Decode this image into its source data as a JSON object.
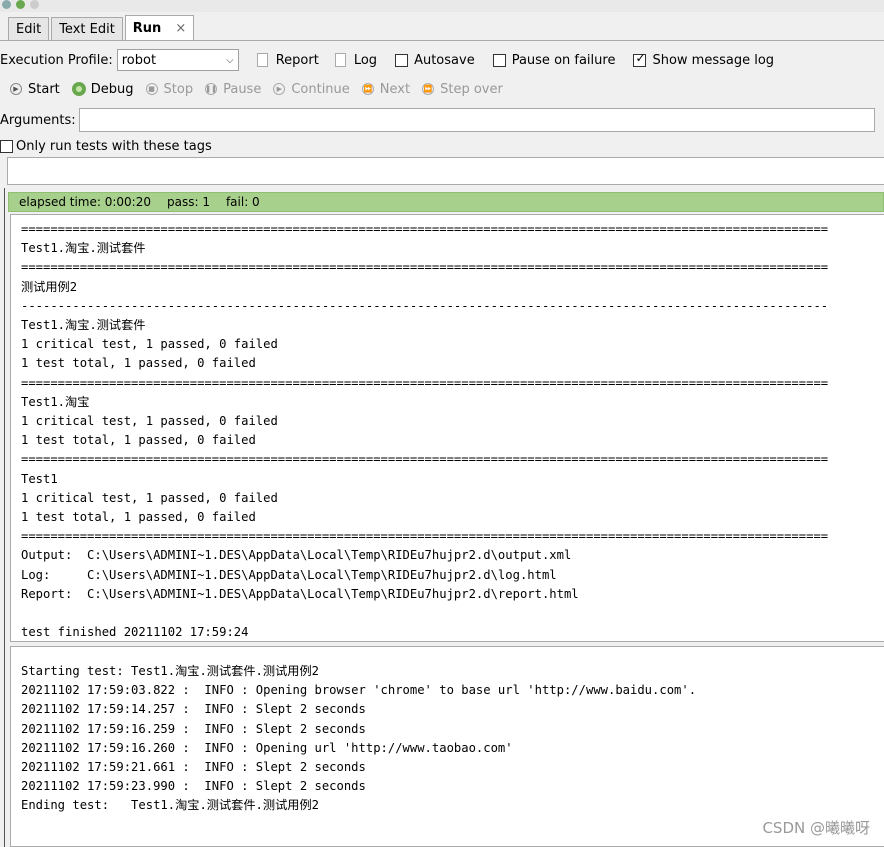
{
  "tabs": [
    {
      "label": "Edit"
    },
    {
      "label": "Text Edit"
    },
    {
      "label": "Run",
      "close": "×"
    }
  ],
  "toolbar": {
    "execution_profile_label": "Execution Profile:",
    "execution_profile_value": "robot",
    "report_label": "Report",
    "log_label": "Log",
    "autosave_label": "Autosave",
    "pause_on_failure_label": "Pause on failure",
    "show_message_log_label": "Show message log",
    "show_message_log_checked": true
  },
  "controls": {
    "start": "Start",
    "debug": "Debug",
    "stop": "Stop",
    "pause": "Pause",
    "continue": "Continue",
    "next": "Next",
    "step_over": "Step over"
  },
  "arguments": {
    "label": "Arguments:",
    "value": ""
  },
  "tags_filter": {
    "label": "Only run tests with these tags",
    "value": ""
  },
  "status": {
    "elapsed": "elapsed time: 0:00:20",
    "pass": "pass: 1",
    "fail": "fail: 0",
    "color": "#a8d08d"
  },
  "output_text": "==============================================================================================================\nTest1.淘宝.测试套件\n==============================================================================================================\n测试用例2\n--------------------------------------------------------------------------------------------------------------\nTest1.淘宝.测试套件\n1 critical test, 1 passed, 0 failed\n1 test total, 1 passed, 0 failed\n==============================================================================================================\nTest1.淘宝\n1 critical test, 1 passed, 0 failed\n1 test total, 1 passed, 0 failed\n==============================================================================================================\nTest1\n1 critical test, 1 passed, 0 failed\n1 test total, 1 passed, 0 failed\n==============================================================================================================\nOutput:  C:\\Users\\ADMINI~1.DES\\AppData\\Local\\Temp\\RIDEu7hujpr2.d\\output.xml\nLog:     C:\\Users\\ADMINI~1.DES\\AppData\\Local\\Temp\\RIDEu7hujpr2.d\\log.html\nReport:  C:\\Users\\ADMINI~1.DES\\AppData\\Local\\Temp\\RIDEu7hujpr2.d\\report.html\n\ntest finished 20211102 17:59:24",
  "message_log_text": "Starting test: Test1.淘宝.测试套件.测试用例2\n20211102 17:59:03.822 :  INFO : Opening browser 'chrome' to base url 'http://www.baidu.com'.\n20211102 17:59:14.257 :  INFO : Slept 2 seconds\n20211102 17:59:16.259 :  INFO : Slept 2 seconds\n20211102 17:59:16.260 :  INFO : Opening url 'http://www.taobao.com'\n20211102 17:59:21.661 :  INFO : Slept 2 seconds\n20211102 17:59:23.990 :  INFO : Slept 2 seconds\nEnding test:   Test1.淘宝.测试套件.测试用例2",
  "watermark": "CSDN @曦曦呀"
}
